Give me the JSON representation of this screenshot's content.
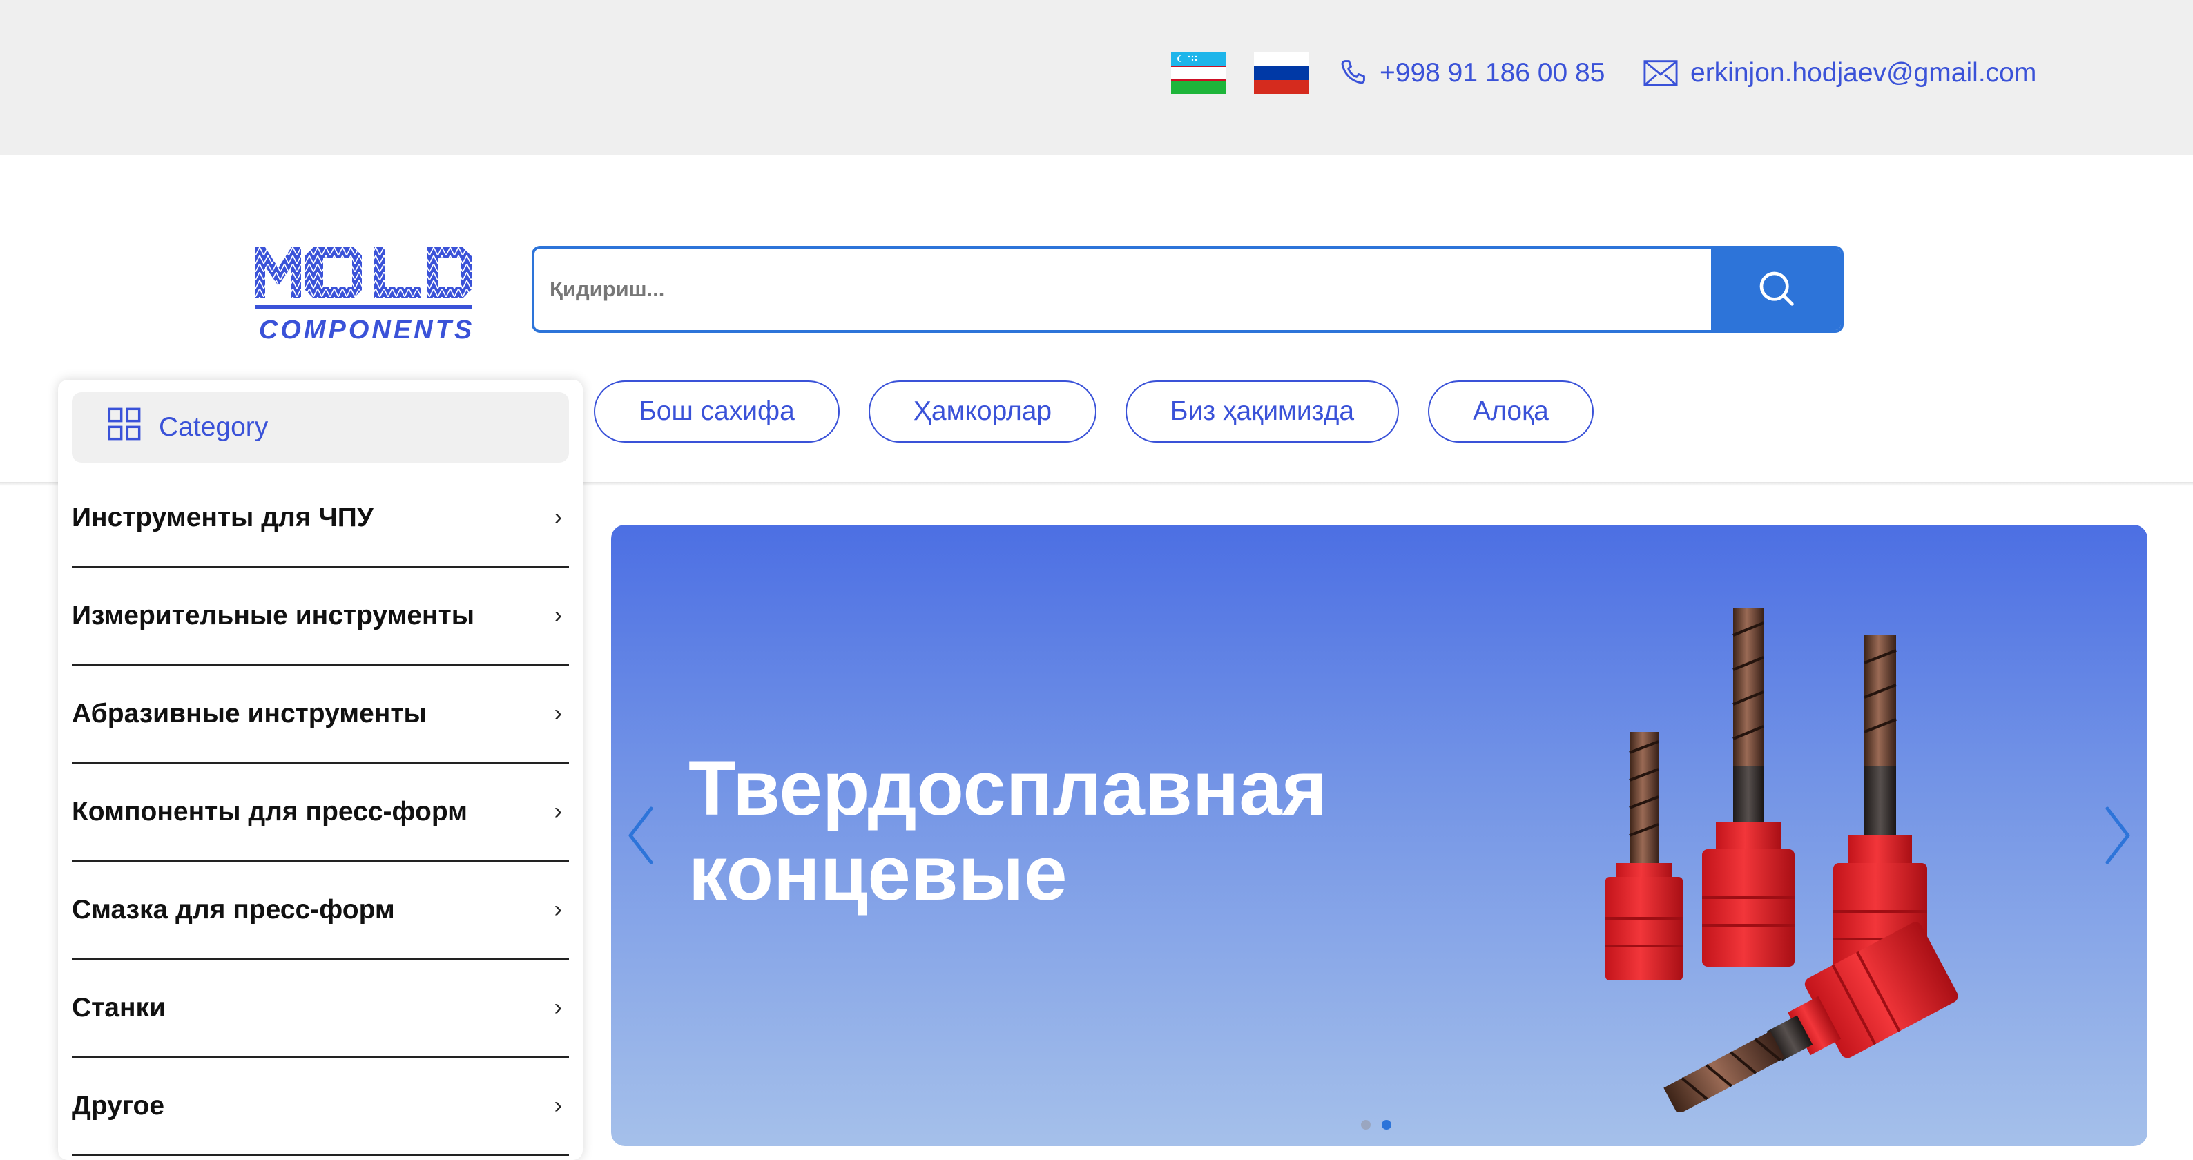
{
  "topbar": {
    "languages": [
      {
        "name": "uzbek-flag",
        "colors": [
          "#1eb5ea",
          "#ffffff",
          "#1eb53a"
        ]
      },
      {
        "name": "russian-flag",
        "colors": [
          "#ffffff",
          "#0039a6",
          "#d52b1e"
        ]
      }
    ],
    "phone": "+998 91 186 00 85",
    "email": "erkinjon.hodjaev@gmail.com",
    "icons": {
      "phone": "phone-icon",
      "email": "envelope-icon"
    }
  },
  "header": {
    "logo": {
      "line1": "MOLD",
      "line2": "COMPONENTS",
      "color": "#3a52d8"
    },
    "search": {
      "placeholder": "Қидириш...",
      "value": "",
      "button_icon": "search-icon"
    },
    "nav": [
      "Бош сахифа",
      "Ҳамкорлар",
      "Биз ҳақимизда",
      "Алоқа"
    ]
  },
  "categories": {
    "title": "Category",
    "icon": "grid-icon",
    "items": [
      "Инструменты для ЧПУ",
      "Измерительные инструменты",
      "Абразивные инструменты",
      "Компоненты для пресс-форм",
      "Смазка для пресс-форм",
      "Станки",
      "Другое"
    ]
  },
  "hero": {
    "title_line1": "Твердосплавная",
    "title_line2": "концевые",
    "slides_count": 2,
    "active_slide": 2,
    "image": "carbide-end-mills-image"
  },
  "colors": {
    "accent": "#3a52d8",
    "primary_button": "#2d74d9",
    "topbar_bg": "#efefef"
  }
}
